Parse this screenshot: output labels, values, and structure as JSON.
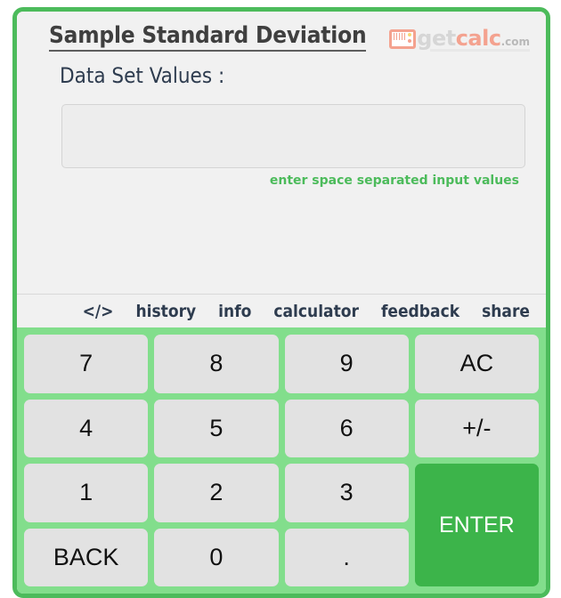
{
  "app": {
    "title": "Sample Standard Deviation",
    "accent_green": "#4CBB5B",
    "keypad_green": "#82DE8C",
    "enter_green": "#3CB44A"
  },
  "logo": {
    "icon": "calculator-icon",
    "part1": "get",
    "part2": "calc",
    "part3": ".com"
  },
  "form": {
    "label": "Data Set Values :",
    "input_value": "",
    "input_placeholder": "",
    "hint": "enter space separated input values"
  },
  "menu": {
    "items": [
      {
        "label": "</>",
        "name": "menu-item-code"
      },
      {
        "label": "history",
        "name": "menu-item-history"
      },
      {
        "label": "info",
        "name": "menu-item-info"
      },
      {
        "label": "calculator",
        "name": "menu-item-calculator"
      },
      {
        "label": "feedback",
        "name": "menu-item-feedback"
      },
      {
        "label": "share",
        "name": "menu-item-share"
      }
    ]
  },
  "keypad": {
    "keys": [
      {
        "label": "7",
        "name": "key-7"
      },
      {
        "label": "8",
        "name": "key-8"
      },
      {
        "label": "9",
        "name": "key-9"
      },
      {
        "label": "AC",
        "name": "key-ac"
      },
      {
        "label": "4",
        "name": "key-4"
      },
      {
        "label": "5",
        "name": "key-5"
      },
      {
        "label": "6",
        "name": "key-6"
      },
      {
        "label": "+/-",
        "name": "key-plus-minus"
      },
      {
        "label": "1",
        "name": "key-1"
      },
      {
        "label": "2",
        "name": "key-2"
      },
      {
        "label": "3",
        "name": "key-3"
      },
      {
        "label": "ENTER",
        "name": "key-enter"
      },
      {
        "label": "BACK",
        "name": "key-back"
      },
      {
        "label": "0",
        "name": "key-0"
      },
      {
        "label": ".",
        "name": "key-decimal"
      }
    ]
  }
}
